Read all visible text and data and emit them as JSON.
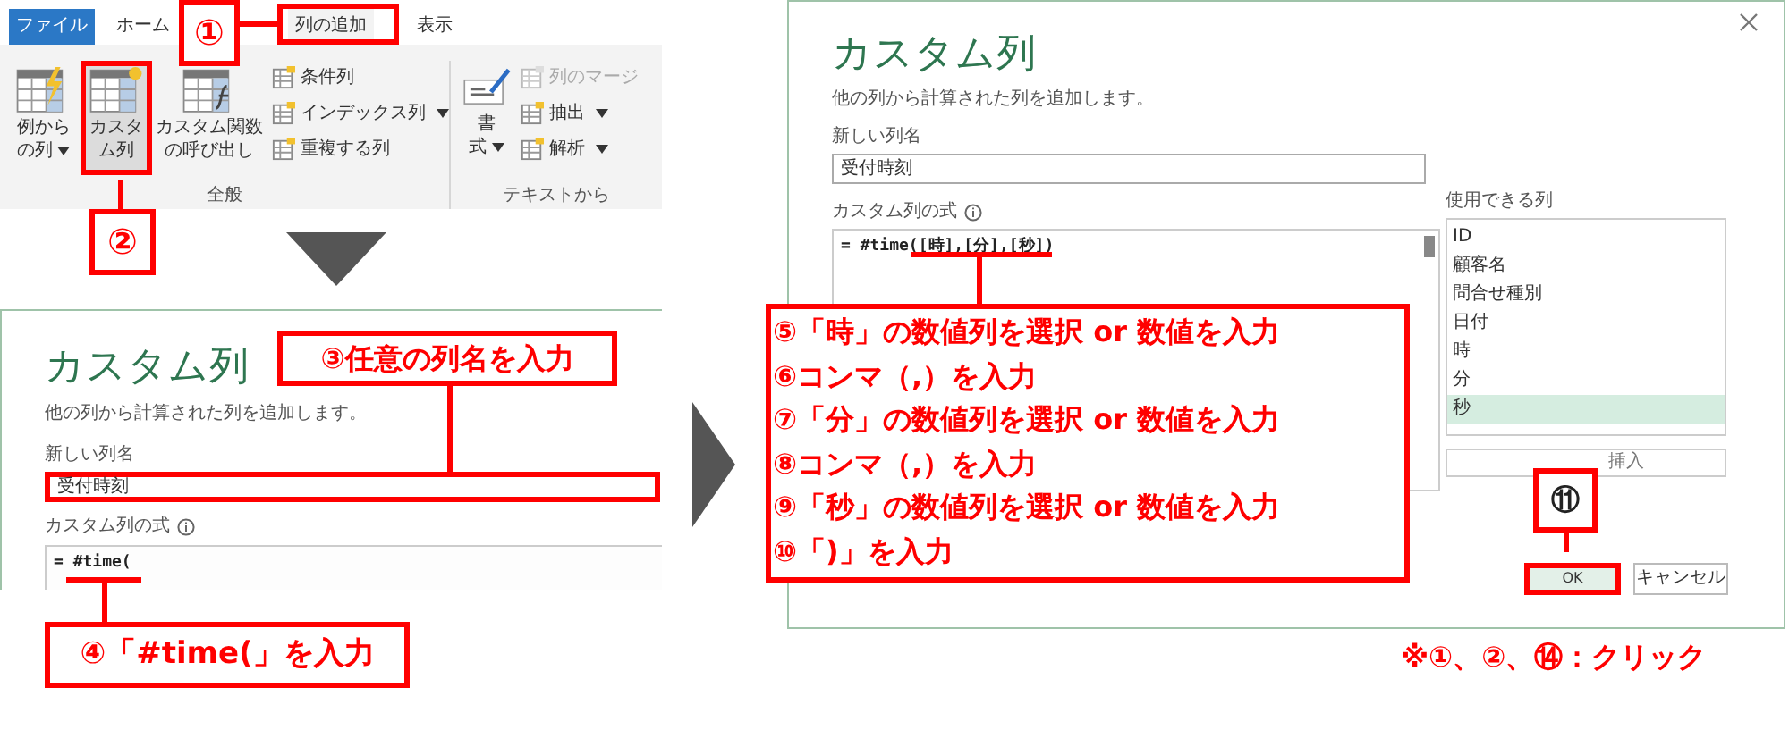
{
  "ribbon": {
    "tabs": [
      {
        "label": "ファイル",
        "kind": "file",
        "selected": false
      },
      {
        "label": "ホーム",
        "kind": "tab",
        "selected": false
      },
      {
        "label": "列の追加",
        "kind": "tab",
        "selected": true
      },
      {
        "label": "表示",
        "kind": "tab",
        "selected": false
      }
    ],
    "groups": [
      {
        "label": "全般",
        "large": [
          {
            "lines": [
              "例から",
              "の列"
            ],
            "dropdown": true,
            "selected": false
          },
          {
            "lines": [
              "カスタ",
              "ム列"
            ],
            "dropdown": false,
            "selected": true
          },
          {
            "lines": [
              "カスタム関数",
              "の呼び出し"
            ],
            "dropdown": false,
            "selected": false
          }
        ],
        "small": [
          {
            "label": "条件列",
            "dropdown": false,
            "disabled": false
          },
          {
            "label": "インデックス列",
            "dropdown": true,
            "disabled": false
          },
          {
            "label": "重複する列",
            "dropdown": false,
            "disabled": false
          }
        ]
      },
      {
        "label": "テキストから",
        "large": [
          {
            "lines": [
              "書",
              "式"
            ],
            "dropdown": true,
            "selected": false
          }
        ],
        "small": [
          {
            "label": "列のマージ",
            "dropdown": false,
            "disabled": true
          },
          {
            "label": "抽出",
            "dropdown": true,
            "disabled": false
          },
          {
            "label": "解析",
            "dropdown": true,
            "disabled": false
          }
        ]
      }
    ]
  },
  "small_dialog": {
    "title": "カスタム列",
    "description": "他の列から計算された列を追加します。",
    "name_label": "新しい列名",
    "name_value": "受付時刻",
    "formula_label": "カスタム列の式",
    "formula_value": "= #time("
  },
  "dialog": {
    "title": "カスタム列",
    "description": "他の列から計算された列を追加します。",
    "name_label": "新しい列名",
    "name_value": "受付時刻",
    "formula_label": "カスタム列の式",
    "formula_value": "= #time([時],[分],[秒])",
    "columns_label": "使用できる列",
    "columns": [
      {
        "label": "ID",
        "selected": false
      },
      {
        "label": "顧客名",
        "selected": false
      },
      {
        "label": "問合せ種別",
        "selected": false
      },
      {
        "label": "日付",
        "selected": false
      },
      {
        "label": "時",
        "selected": false
      },
      {
        "label": "分",
        "selected": false
      },
      {
        "label": "秒",
        "selected": true
      }
    ],
    "insert_button": "挿入",
    "ok_button": "OK",
    "cancel_button": "キャンセル"
  },
  "callouts": {
    "step1": "①",
    "step2": "②",
    "step3": "③任意の列名を入力",
    "step4": "④「#time(」を入力",
    "step11": "⑪",
    "steps": [
      "⑤「時」の数値列を選択 or 数値を入力",
      "⑥コンマ（,）を入力",
      "⑦「分」の数値列を選択 or 数値を入力",
      "⑧コンマ（,）を入力",
      "⑨「秒」の数値列を選択 or 数値を入力",
      "⑩「)」を入力"
    ],
    "note": "※①、②、⑭：クリック"
  }
}
